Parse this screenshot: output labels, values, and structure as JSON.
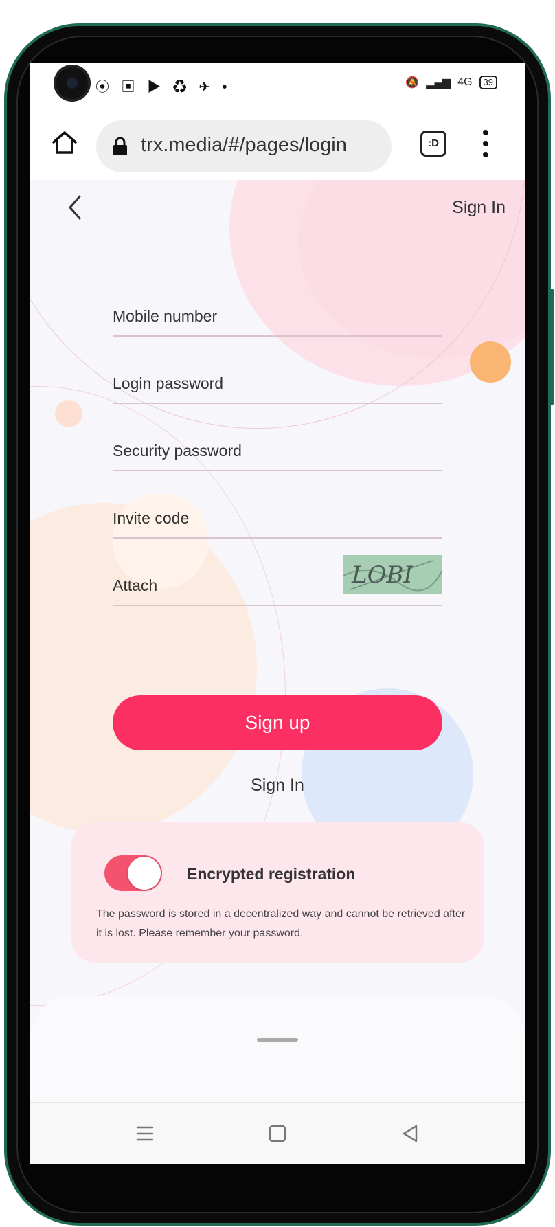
{
  "browser": {
    "url": "trx.media/#/pages/login",
    "tab_switcher_label": ":D"
  },
  "status_bar": {
    "network": "4G",
    "battery": "39"
  },
  "header": {
    "sign_in_label": "Sign In"
  },
  "form": {
    "mobile_label": "Mobile number",
    "login_password_label": "Login password",
    "security_password_label": "Security password",
    "invite_code_label": "Invite code",
    "attach_label": "Attach",
    "captcha_text": "LOBI",
    "signup_label": "Sign up",
    "signin_link_label": "Sign In"
  },
  "encrypted_card": {
    "title": "Encrypted registration",
    "description": "The password is stored in a decentralized way and cannot be retrieved after it is lost. Please remember your password.",
    "toggle_on": true
  },
  "colors": {
    "accent": "#fb2f61",
    "toggle": "#f4536f",
    "card_bg": "#fde7ec",
    "frame": "#1f6b55"
  },
  "icons": [
    "home-icon",
    "lock-icon",
    "tab-switcher-icon",
    "overflow-menu-icon",
    "back-icon",
    "recents-icon",
    "home-nav-icon",
    "back-nav-icon"
  ]
}
